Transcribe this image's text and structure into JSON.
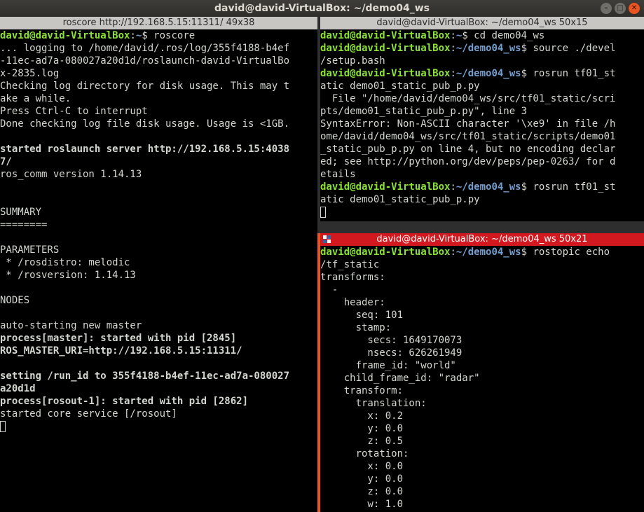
{
  "window": {
    "title": "david@david-VirtualBox: ~/demo04_ws",
    "buttons": {
      "minimize": "–",
      "maximize": "□",
      "close": "✕"
    },
    "accent_color": "#e95420"
  },
  "panes": {
    "left": {
      "title": "roscore http://192.168.5.15:11311/ 49x38",
      "lines": [
        {
          "segs": [
            {
              "t": "david@david-VirtualBox",
              "c": "user"
            },
            {
              "t": ":"
            },
            {
              "t": "~",
              "c": "path"
            },
            {
              "t": "$ roscore"
            }
          ]
        },
        {
          "segs": [
            {
              "t": "... logging to /home/david/.ros/log/355f4188-b4ef"
            }
          ]
        },
        {
          "segs": [
            {
              "t": "-11ec-ad7a-080027a20d1d/roslaunch-david-VirtualBo"
            }
          ]
        },
        {
          "segs": [
            {
              "t": "x-2835.log"
            }
          ]
        },
        {
          "segs": [
            {
              "t": "Checking log directory for disk usage. This may t"
            }
          ]
        },
        {
          "segs": [
            {
              "t": "ake a while."
            }
          ]
        },
        {
          "segs": [
            {
              "t": "Press Ctrl-C to interrupt"
            }
          ]
        },
        {
          "segs": [
            {
              "t": "Done checking log file disk usage. Usage is <1GB."
            }
          ]
        },
        {
          "segs": []
        },
        {
          "segs": [
            {
              "t": "started roslaunch server http://192.168.5.15:4038",
              "c": "b"
            }
          ]
        },
        {
          "segs": [
            {
              "t": "7/",
              "c": "b"
            }
          ]
        },
        {
          "segs": [
            {
              "t": "ros_comm version 1.14.13"
            }
          ]
        },
        {
          "segs": []
        },
        {
          "segs": []
        },
        {
          "segs": [
            {
              "t": "SUMMARY"
            }
          ]
        },
        {
          "segs": [
            {
              "t": "========"
            }
          ]
        },
        {
          "segs": []
        },
        {
          "segs": [
            {
              "t": "PARAMETERS"
            }
          ]
        },
        {
          "segs": [
            {
              "t": " * /rosdistro: melodic"
            }
          ]
        },
        {
          "segs": [
            {
              "t": " * /rosversion: 1.14.13"
            }
          ]
        },
        {
          "segs": []
        },
        {
          "segs": [
            {
              "t": "NODES"
            }
          ]
        },
        {
          "segs": []
        },
        {
          "segs": [
            {
              "t": "auto-starting new master"
            }
          ]
        },
        {
          "segs": [
            {
              "t": "process[master]: started with pid [2845]",
              "c": "b"
            }
          ]
        },
        {
          "segs": [
            {
              "t": "ROS_MASTER_URI=http://192.168.5.15:11311/",
              "c": "b"
            }
          ]
        },
        {
          "segs": []
        },
        {
          "segs": [
            {
              "t": "setting /run_id to 355f4188-b4ef-11ec-ad7a-080027",
              "c": "b"
            }
          ]
        },
        {
          "segs": [
            {
              "t": "a20d1d",
              "c": "b"
            }
          ]
        },
        {
          "segs": [
            {
              "t": "process[rosout-1]: started with pid [2862]",
              "c": "b"
            }
          ]
        },
        {
          "segs": [
            {
              "t": "started core service [/rosout]"
            }
          ]
        },
        {
          "segs": [
            {
              "cursor": true
            }
          ]
        }
      ]
    },
    "top_right": {
      "title": "david@david-VirtualBox: ~/demo04_ws 50x15",
      "lines": [
        {
          "segs": [
            {
              "t": "david@david-VirtualBox",
              "c": "user"
            },
            {
              "t": ":"
            },
            {
              "t": "~",
              "c": "path"
            },
            {
              "t": "$ cd demo04_ws"
            }
          ]
        },
        {
          "segs": [
            {
              "t": "david@david-VirtualBox",
              "c": "user"
            },
            {
              "t": ":"
            },
            {
              "t": "~/demo04_ws",
              "c": "path"
            },
            {
              "t": "$ source ./devel"
            }
          ]
        },
        {
          "segs": [
            {
              "t": "/setup.bash"
            }
          ]
        },
        {
          "segs": [
            {
              "t": "david@david-VirtualBox",
              "c": "user"
            },
            {
              "t": ":"
            },
            {
              "t": "~/demo04_ws",
              "c": "path"
            },
            {
              "t": "$ rosrun tf01_st"
            }
          ]
        },
        {
          "segs": [
            {
              "t": "atic demo01_static_pub_p.py"
            }
          ]
        },
        {
          "segs": [
            {
              "t": "  File \"/home/david/demo04_ws/src/tf01_static/scri"
            }
          ]
        },
        {
          "segs": [
            {
              "t": "pts/demo01_static_pub_p.py\", line 3"
            }
          ]
        },
        {
          "segs": [
            {
              "t": "SyntaxError: Non-ASCII character '\\xe9' in file /h"
            }
          ]
        },
        {
          "segs": [
            {
              "t": "ome/david/demo04_ws/src/tf01_static/scripts/demo01"
            }
          ]
        },
        {
          "segs": [
            {
              "t": "_static_pub_p.py on line 4, but no encoding declar"
            }
          ]
        },
        {
          "segs": [
            {
              "t": "ed; see http://python.org/dev/peps/pep-0263/ for d"
            }
          ]
        },
        {
          "segs": [
            {
              "t": "etails"
            }
          ]
        },
        {
          "segs": [
            {
              "t": "david@david-VirtualBox",
              "c": "user"
            },
            {
              "t": ":"
            },
            {
              "t": "~/demo04_ws",
              "c": "path"
            },
            {
              "t": "$ rosrun tf01_st"
            }
          ]
        },
        {
          "segs": [
            {
              "t": "atic demo01_static_pub_p.py"
            }
          ]
        },
        {
          "segs": [
            {
              "cursor": true
            }
          ]
        }
      ]
    },
    "bottom_right": {
      "title": "david@david-VirtualBox: ~/demo04_ws 50x21",
      "lines": [
        {
          "segs": [
            {
              "t": "david@david-VirtualBox",
              "c": "user"
            },
            {
              "t": ":"
            },
            {
              "t": "~/demo04_ws",
              "c": "path"
            },
            {
              "t": "$ rostopic echo"
            }
          ]
        },
        {
          "segs": [
            {
              "t": "/tf_static"
            }
          ]
        },
        {
          "segs": [
            {
              "t": "transforms:"
            }
          ]
        },
        {
          "segs": [
            {
              "t": "  -"
            }
          ]
        },
        {
          "segs": [
            {
              "t": "    header:"
            }
          ]
        },
        {
          "segs": [
            {
              "t": "      seq: 101"
            }
          ]
        },
        {
          "segs": [
            {
              "t": "      stamp:"
            }
          ]
        },
        {
          "segs": [
            {
              "t": "        secs: 1649170073"
            }
          ]
        },
        {
          "segs": [
            {
              "t": "        nsecs: 626261949"
            }
          ]
        },
        {
          "segs": [
            {
              "t": "      frame_id: \"world\""
            }
          ]
        },
        {
          "segs": [
            {
              "t": "    child_frame_id: \"radar\""
            }
          ]
        },
        {
          "segs": [
            {
              "t": "    transform:"
            }
          ]
        },
        {
          "segs": [
            {
              "t": "      translation:"
            }
          ]
        },
        {
          "segs": [
            {
              "t": "        x: 0.2"
            }
          ]
        },
        {
          "segs": [
            {
              "t": "        y: 0.0"
            }
          ]
        },
        {
          "segs": [
            {
              "t": "        z: 0.5"
            }
          ]
        },
        {
          "segs": [
            {
              "t": "      rotation:"
            }
          ]
        },
        {
          "segs": [
            {
              "t": "        x: 0.0"
            }
          ]
        },
        {
          "segs": [
            {
              "t": "        y: 0.0"
            }
          ]
        },
        {
          "segs": [
            {
              "t": "        z: 0.0"
            }
          ]
        },
        {
          "segs": [
            {
              "t": "        w: 1.0"
            }
          ]
        }
      ]
    }
  }
}
